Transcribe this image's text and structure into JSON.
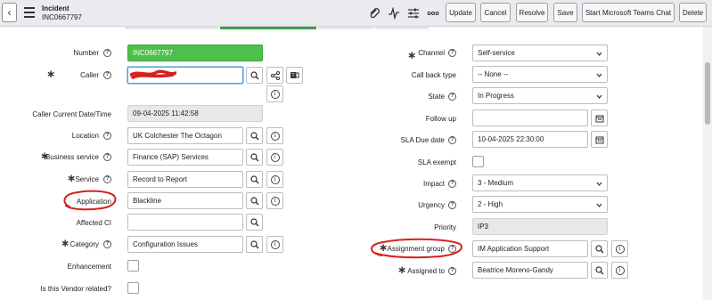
{
  "header": {
    "title": "Incident",
    "number": "INC0667797",
    "buttons": {
      "update": "Update",
      "cancel": "Cancel",
      "resolve": "Resolve",
      "save": "Save",
      "teams": "Start Microsoft Teams Chat",
      "delete": "Delete"
    },
    "icons": [
      "paperclip-icon",
      "activity-icon",
      "sliders-icon",
      "more-icon"
    ]
  },
  "progress": {
    "active_step": 2
  },
  "left": {
    "number": {
      "label": "Number",
      "value": "INC0667797"
    },
    "caller": {
      "label": "Caller",
      "value": ""
    },
    "caller_date": {
      "label": "Caller Current Date/Time",
      "value": "09-04-2025 11:42:58"
    },
    "location": {
      "label": "Location",
      "value": "UK Colchester The Octagon"
    },
    "business_service": {
      "label": "Business service",
      "value": "Finance (SAP) Services"
    },
    "service": {
      "label": "Service",
      "value": "Record to Report"
    },
    "application": {
      "label": "Application",
      "value": "Blackline"
    },
    "affected_ci": {
      "label": "Affected CI",
      "value": ""
    },
    "category": {
      "label": "Category",
      "value": "Configuration Issues"
    },
    "enhancement": {
      "label": "Enhancement"
    },
    "vendor": {
      "label": "Is this Vendor related?"
    }
  },
  "right": {
    "channel": {
      "label": "Channel",
      "value": "Self-service"
    },
    "call_back": {
      "label": "Call back type",
      "value": "-- None --"
    },
    "state": {
      "label": "State",
      "value": "In Progress"
    },
    "follow_up": {
      "label": "Follow up",
      "value": ""
    },
    "sla_due": {
      "label": "SLA Due date",
      "value": "10-04-2025 22:30:00"
    },
    "sla_exempt": {
      "label": "SLA exempt"
    },
    "impact": {
      "label": "Impact",
      "value": "3 - Medium"
    },
    "urgency": {
      "label": "Urgency",
      "value": "2 - High"
    },
    "priority": {
      "label": "Priority",
      "value": "IP3"
    },
    "assignment_group": {
      "label": "Assignment group",
      "value": "IM Application Support"
    },
    "assigned_to": {
      "label": "Assigned to",
      "value": "Beatrice Moreno-Gandy"
    }
  },
  "colors": {
    "number_bg": "#4cc04a",
    "progress_active": "#3a9e4a",
    "annotation": "#d9201c"
  }
}
